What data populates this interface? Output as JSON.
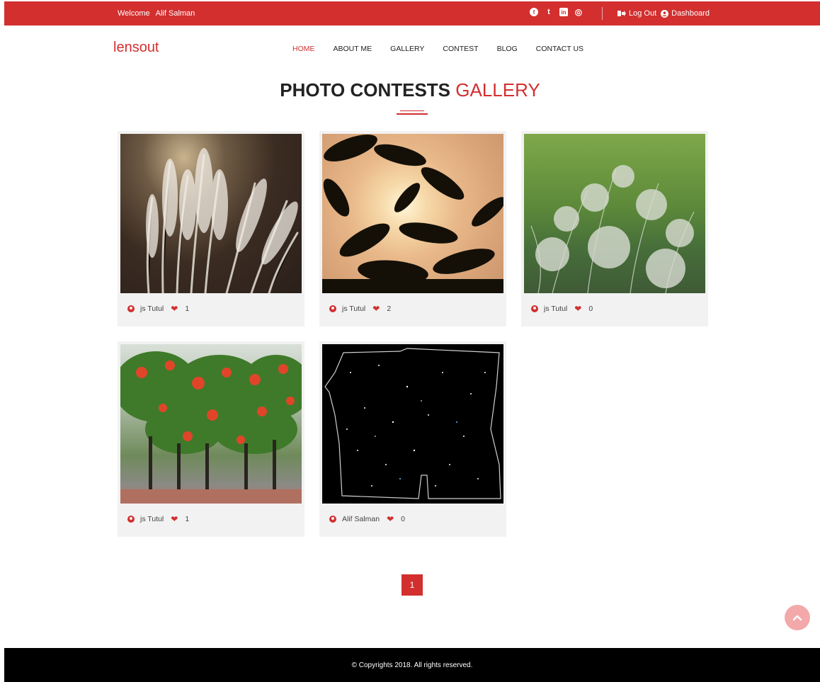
{
  "topbar": {
    "welcome": "Welcome",
    "user": "Alif Salman",
    "social": [
      {
        "icon": "facebook-icon",
        "glyph": "f"
      },
      {
        "icon": "twitter-icon",
        "glyph": "t"
      },
      {
        "icon": "linkedin-icon",
        "glyph": "in"
      },
      {
        "icon": "instagram-icon",
        "glyph": "◎"
      }
    ],
    "logout": "Log Out",
    "dashboard": "Dashboard"
  },
  "brand": {
    "logo": "lensout"
  },
  "nav": {
    "items": [
      {
        "label": "HOME",
        "active": true
      },
      {
        "label": "ABOUT ME",
        "active": false
      },
      {
        "label": "GALLERY",
        "active": false
      },
      {
        "label": "CONTEST",
        "active": false
      },
      {
        "label": "BLOG",
        "active": false
      },
      {
        "label": "CONTACT US",
        "active": false
      }
    ]
  },
  "heading": {
    "main": "PHOTO CONTESTS",
    "accent": "GALLERY"
  },
  "gallery": {
    "cards": [
      {
        "photo": "pampas-grass-photo",
        "author": "js Tutul",
        "likes": "1"
      },
      {
        "photo": "sunset-leaves-photo",
        "author": "js Tutul",
        "likes": "2"
      },
      {
        "photo": "green-plant-photo",
        "author": "js Tutul",
        "likes": "0"
      },
      {
        "photo": "flame-trees-photo",
        "author": "js Tutul",
        "likes": "1"
      },
      {
        "photo": "star-field-photo",
        "author": "Alif Salman",
        "likes": "0"
      }
    ]
  },
  "pagination": {
    "current": "1"
  },
  "footer": {
    "text": "© Copyrights 2018. All rights reserved."
  },
  "colors": {
    "accent": "#d32f2f",
    "footer_bg": "#000000",
    "card_bg": "#f2f2f2"
  }
}
